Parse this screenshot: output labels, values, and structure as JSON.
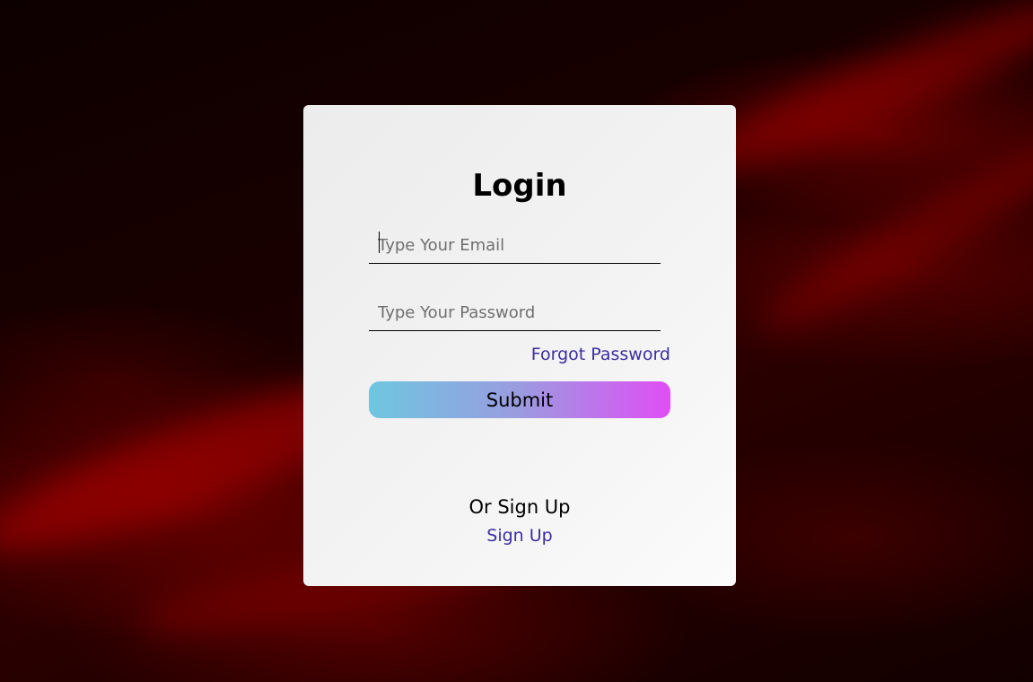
{
  "login": {
    "title": "Login",
    "email_placeholder": "Type Your Email",
    "password_placeholder": "Type Your Password",
    "forgot_label": "Forgot Password",
    "submit_label": "Submit",
    "or_text": "Or Sign Up",
    "signup_label": "Sign Up"
  },
  "colors": {
    "link": "#3b2ea0",
    "button_gradient_start": "#6ec6e0",
    "button_gradient_end": "#e04ef5",
    "background": "#1a0000"
  }
}
